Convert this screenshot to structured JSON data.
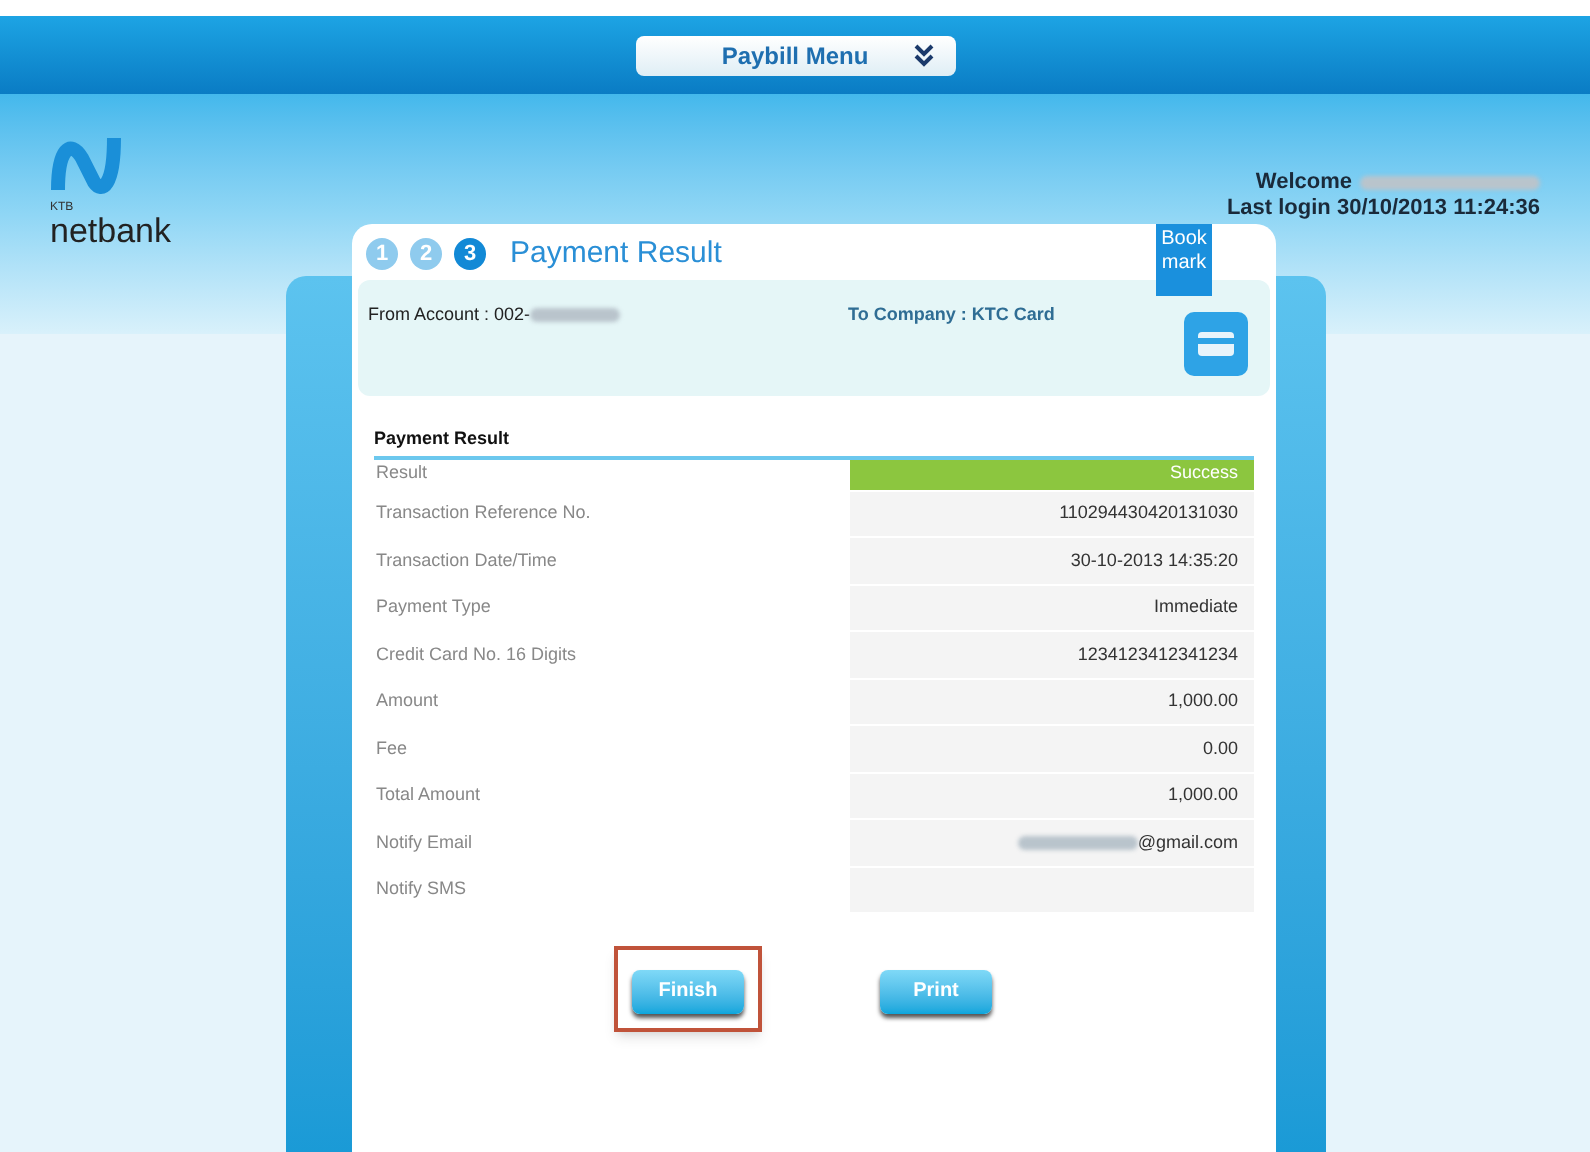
{
  "menu_button": {
    "label": "Paybill Menu"
  },
  "logo": {
    "small": "KTB",
    "name": "netbank"
  },
  "user": {
    "welcome": "Welcome",
    "last_login": "Last login 30/10/2013 11:24:36"
  },
  "steps": [
    {
      "label": "1",
      "selected": false
    },
    {
      "label": "2",
      "selected": false
    },
    {
      "label": "3",
      "selected": true
    }
  ],
  "page_title": "Payment Result",
  "bookmark": {
    "line1": "Book",
    "line2": "mark"
  },
  "summary": {
    "from_account": "From Account : 002-",
    "to_company": "To Company : KTC Card"
  },
  "section_title": "Payment Result",
  "rows": [
    {
      "label": "Result",
      "value": "Success",
      "kind": "status"
    },
    {
      "label": "Transaction Reference No.",
      "value": "110294430420131030",
      "kind": "plain"
    },
    {
      "label": "Transaction Date/Time",
      "value": "30-10-2013 14:35:20",
      "kind": "plain"
    },
    {
      "label": "Payment Type",
      "value": "Immediate",
      "kind": "plain"
    },
    {
      "label": "Credit Card No. 16 Digits",
      "value": "1234123412341234",
      "kind": "plain"
    },
    {
      "label": "Amount",
      "value": "1,000.00",
      "kind": "plain"
    },
    {
      "label": "Fee",
      "value": "0.00",
      "kind": "plain"
    },
    {
      "label": "Total Amount",
      "value": "1,000.00",
      "kind": "plain"
    },
    {
      "label": "Notify Email",
      "value": "@gmail.com",
      "kind": "redacted"
    },
    {
      "label": "Notify SMS",
      "kind": "plain"
    }
  ],
  "buttons": [
    {
      "label": "Finish",
      "highlighted": true
    },
    {
      "label": "Print",
      "highlighted": false
    }
  ]
}
